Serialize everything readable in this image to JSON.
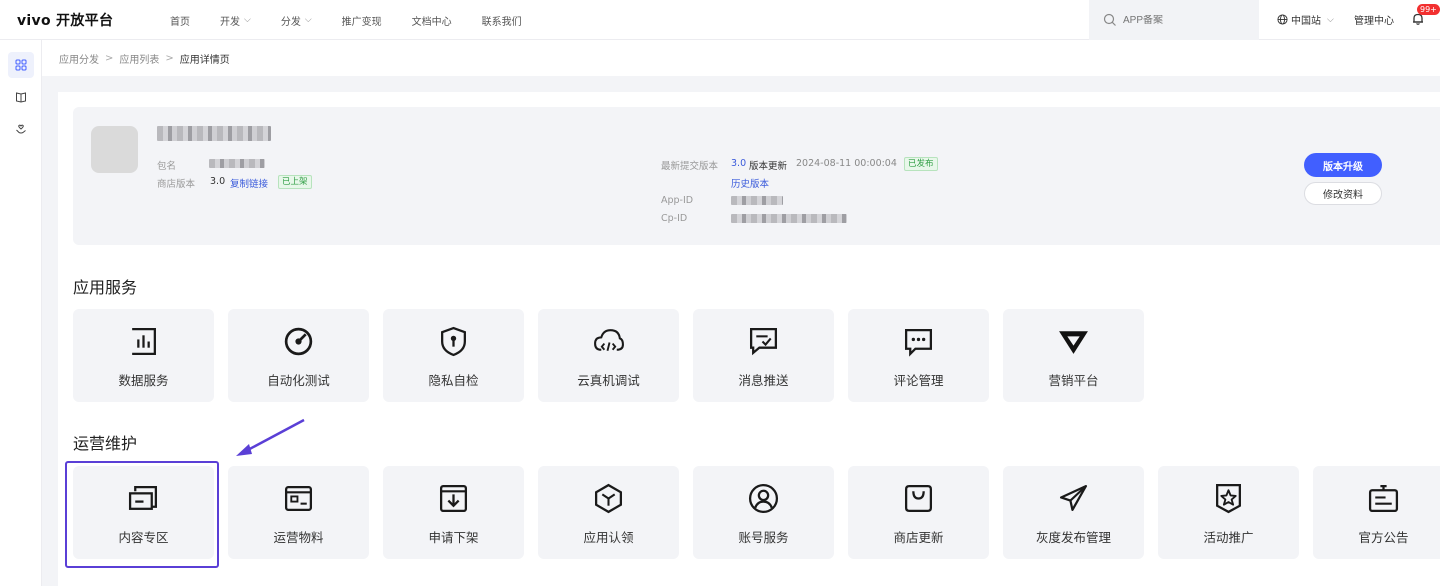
{
  "header": {
    "logo": "vivo 开放平台",
    "nav": [
      {
        "label": "首页",
        "dropdown": false
      },
      {
        "label": "开发",
        "dropdown": true
      },
      {
        "label": "分发",
        "dropdown": true
      },
      {
        "label": "推广变现",
        "dropdown": false
      },
      {
        "label": "文档中心",
        "dropdown": false
      },
      {
        "label": "联系我们",
        "dropdown": false
      }
    ],
    "search_placeholder": "APP备案",
    "region": "中国站",
    "mgmt": "管理中心",
    "notif_count": "99+"
  },
  "rail": {
    "icons": [
      "grid-icon",
      "book-icon",
      "heart-hand-icon"
    ]
  },
  "breadcrumb": {
    "items": [
      "应用分发",
      "应用列表",
      "应用详情页"
    ],
    "separator": ">"
  },
  "app": {
    "pkg_label": "包名",
    "store_version_label": "商店版本",
    "store_version": "3.0",
    "copy_link": "复制链接",
    "status_listed": "已上架",
    "latest_label": "最新提交版本",
    "latest_version": "3.0",
    "latest_kind": "版本更新",
    "latest_time": "2024-08-11 00:00:04",
    "latest_status": "已发布",
    "history_link": "历史版本",
    "appid_label": "App-ID",
    "cpid_label": "Cp-ID",
    "upgrade_button": "版本升级",
    "edit_button": "修改资料"
  },
  "sections": [
    {
      "title": "应用服务",
      "tiles": [
        {
          "label": "数据服务",
          "icon": "data-chart-icon"
        },
        {
          "label": "自动化测试",
          "icon": "auto-test-icon"
        },
        {
          "label": "隐私自检",
          "icon": "privacy-shield-icon"
        },
        {
          "label": "云真机调试",
          "icon": "cloud-code-icon"
        },
        {
          "label": "消息推送",
          "icon": "message-push-icon"
        },
        {
          "label": "评论管理",
          "icon": "comment-icon"
        },
        {
          "label": "营销平台",
          "icon": "marketing-icon"
        }
      ]
    },
    {
      "title": "运营维护",
      "tiles": [
        {
          "label": "内容专区",
          "icon": "content-zone-icon"
        },
        {
          "label": "运营物料",
          "icon": "materials-icon"
        },
        {
          "label": "申请下架",
          "icon": "download-box-icon"
        },
        {
          "label": "应用认领",
          "icon": "cube-icon"
        },
        {
          "label": "账号服务",
          "icon": "user-icon"
        },
        {
          "label": "商店更新",
          "icon": "shopping-bag-icon"
        },
        {
          "label": "灰度发布管理",
          "icon": "paper-plane-icon"
        },
        {
          "label": "活动推广",
          "icon": "star-badge-icon"
        },
        {
          "label": "官方公告",
          "icon": "announcement-icon"
        }
      ]
    }
  ],
  "colors": {
    "primary": "#415fff",
    "highlight": "#5a3fd6",
    "tile_bg": "#f3f4f7"
  }
}
